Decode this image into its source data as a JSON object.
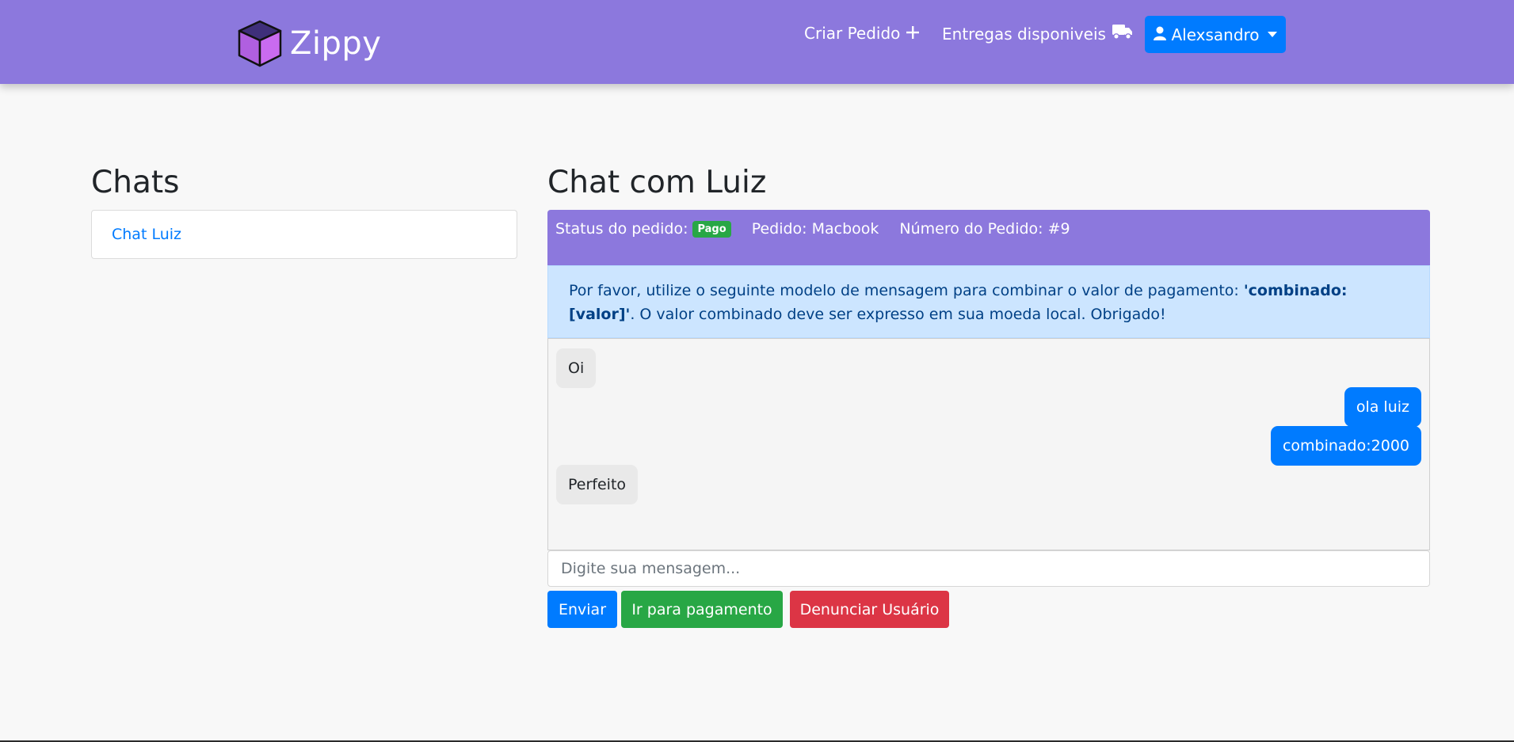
{
  "navbar": {
    "brand": "Zippy",
    "create_order_label": "Criar Pedido",
    "available_deliveries_label": "Entregas disponiveis",
    "user_label": "Alexsandro"
  },
  "sidebar": {
    "title": "Chats",
    "items": [
      {
        "label": "Chat Luiz"
      }
    ]
  },
  "chat": {
    "title": "Chat com Luiz",
    "status_label": "Status do pedido:",
    "status_badge": "Pago",
    "order_label": "Pedido: Macbook",
    "order_number_label": "Número do Pedido: #9",
    "notice_prefix": "Por favor, utilize o seguinte modelo de mensagem para combinar o valor de pagamento: ",
    "notice_template": "'combinado: [valor]'",
    "notice_suffix": ". O valor combinado deve ser expresso em sua moeda local. Obrigado!",
    "messages": [
      {
        "text": "Oi",
        "direction": "received"
      },
      {
        "text": "ola luiz",
        "direction": "sent"
      },
      {
        "text": "combinado:2000",
        "direction": "sent"
      },
      {
        "text": "Perfeito",
        "direction": "received"
      }
    ],
    "input_placeholder": "Digite sua mensagem...",
    "send_label": "Enviar",
    "pay_label": "Ir para pagamento",
    "report_label": "Denunciar Usuário"
  },
  "colors": {
    "navbar": "#8c78dd",
    "primary": "#007bff",
    "success": "#28a745",
    "danger": "#dc3545",
    "info_bg": "#cce5ff"
  },
  "icons": [
    "cube-logo-icon",
    "plus-icon",
    "truck-icon",
    "user-icon",
    "caret-down-icon"
  ]
}
